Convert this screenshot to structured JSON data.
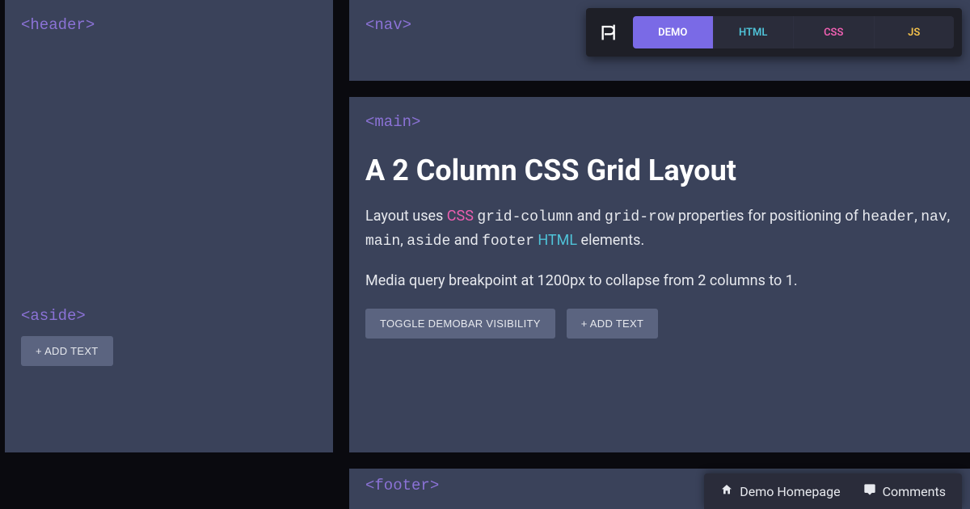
{
  "tags": {
    "header": "<header>",
    "nav": "<nav>",
    "main": "<main>",
    "aside": "<aside>",
    "footer": "<footer>"
  },
  "main": {
    "title": "A 2 Column CSS Grid Layout",
    "para1": {
      "t1": "Layout uses ",
      "css": "CSS",
      "t2": " ",
      "c1": "grid-column",
      "t3": " and ",
      "c2": "grid-row",
      "t4": " properties for positioning of ",
      "c3": "header",
      "t5": ", ",
      "c4": "nav",
      "t6": ", ",
      "c5": "main",
      "t7": ", ",
      "c6": "aside",
      "t8": " and ",
      "c7": "footer",
      "t9": " ",
      "html": "HTML",
      "t10": " elements."
    },
    "para2": "Media query breakpoint at 1200px to collapse from 2 columns to 1.",
    "btn_toggle": "TOGGLE DEMOBAR VISIBILITY",
    "btn_add": "+ ADD TEXT"
  },
  "aside": {
    "btn_add": "+ ADD TEXT"
  },
  "demobar": {
    "logo": "ℙ",
    "tabs": {
      "demo": "DEMO",
      "html": "HTML",
      "css": "CSS",
      "js": "JS"
    }
  },
  "bottombar": {
    "home": "Demo Homepage",
    "comments": "Comments"
  }
}
